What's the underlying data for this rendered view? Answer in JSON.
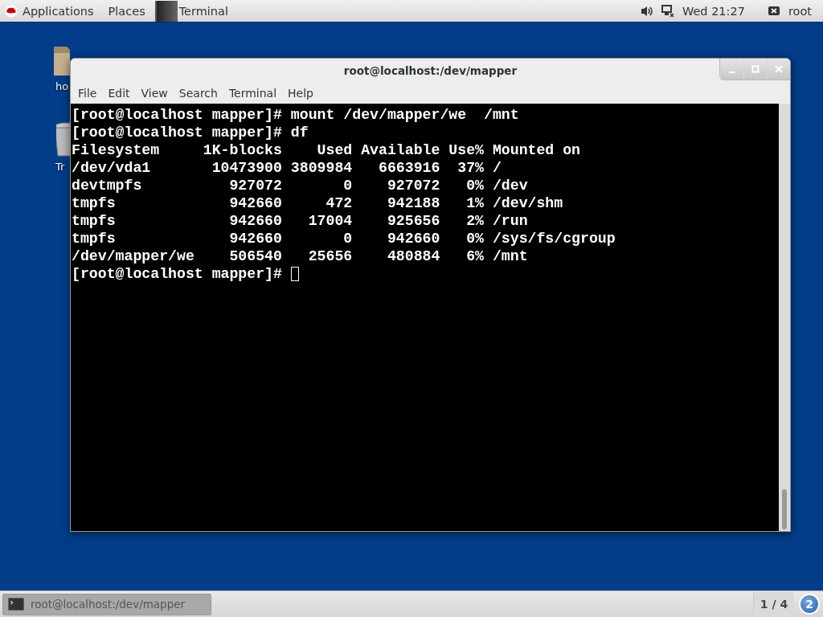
{
  "top_bar": {
    "menus": [
      "Applications",
      "Places"
    ],
    "active_app": "Terminal",
    "clock": "Wed 21:27",
    "user": "root"
  },
  "desktop_icons": [
    {
      "label": "ho",
      "kind": "home"
    },
    {
      "label": "Tr",
      "kind": "trash"
    }
  ],
  "window": {
    "title": "root@localhost:/dev/mapper",
    "menu": [
      "File",
      "Edit",
      "View",
      "Search",
      "Terminal",
      "Help"
    ],
    "lines": [
      "[root@localhost mapper]# mount /dev/mapper/we  /mnt",
      "[root@localhost mapper]# df",
      "Filesystem     1K-blocks    Used Available Use% Mounted on",
      "/dev/vda1       10473900 3809984   6663916  37% /",
      "devtmpfs          927072       0    927072   0% /dev",
      "tmpfs             942660     472    942188   1% /dev/shm",
      "tmpfs             942660   17004    925656   2% /run",
      "tmpfs             942660       0    942660   0% /sys/fs/cgroup",
      "/dev/mapper/we    506540   25656    480884   6% /mnt",
      "[root@localhost mapper]# "
    ]
  },
  "taskbar": {
    "tasks": [
      {
        "label": "root@localhost:/dev/mapper",
        "selected": true
      }
    ],
    "workspace": "1 / 4",
    "notifications": "2"
  }
}
